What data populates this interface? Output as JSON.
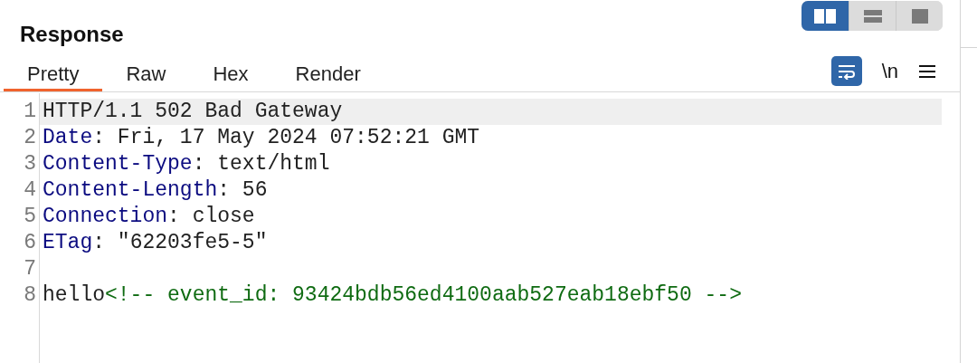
{
  "title": "Response",
  "layout_buttons": [
    {
      "kind": "columns",
      "selected": true
    },
    {
      "kind": "rows",
      "selected": false
    },
    {
      "kind": "single",
      "selected": false
    }
  ],
  "tabs": [
    {
      "label": "Pretty",
      "selected": true
    },
    {
      "label": "Raw",
      "selected": false
    },
    {
      "label": "Hex",
      "selected": false
    },
    {
      "label": "Render",
      "selected": false
    }
  ],
  "toolbar": {
    "wrap_on": true,
    "newline_label": "\\n"
  },
  "lines": [
    {
      "number": "1",
      "highlighted": true,
      "segments": [
        {
          "kind": "text",
          "text": "HTTP/1.1 502 Bad Gateway"
        }
      ]
    },
    {
      "number": "2",
      "highlighted": false,
      "segments": [
        {
          "kind": "key",
          "text": "Date"
        },
        {
          "kind": "text",
          "text": ": Fri, 17 May 2024 07:52:21 GMT"
        }
      ]
    },
    {
      "number": "3",
      "highlighted": false,
      "segments": [
        {
          "kind": "key",
          "text": "Content-Type"
        },
        {
          "kind": "text",
          "text": ": text/html"
        }
      ]
    },
    {
      "number": "4",
      "highlighted": false,
      "segments": [
        {
          "kind": "key",
          "text": "Content-Length"
        },
        {
          "kind": "text",
          "text": ": 56"
        }
      ]
    },
    {
      "number": "5",
      "highlighted": false,
      "segments": [
        {
          "kind": "key",
          "text": "Connection"
        },
        {
          "kind": "text",
          "text": ": close"
        }
      ]
    },
    {
      "number": "6",
      "highlighted": false,
      "segments": [
        {
          "kind": "key",
          "text": "ETag"
        },
        {
          "kind": "text",
          "text": ": \"62203fe5-5\""
        }
      ]
    },
    {
      "number": "7",
      "highlighted": false
    },
    {
      "number": "8",
      "highlighted": false,
      "segments": [
        {
          "kind": "text",
          "text": "hello"
        },
        {
          "kind": "comment",
          "text": "<!-- event_id: 93424bdb56ed4100aab527eab18ebf50 -->"
        }
      ]
    }
  ]
}
